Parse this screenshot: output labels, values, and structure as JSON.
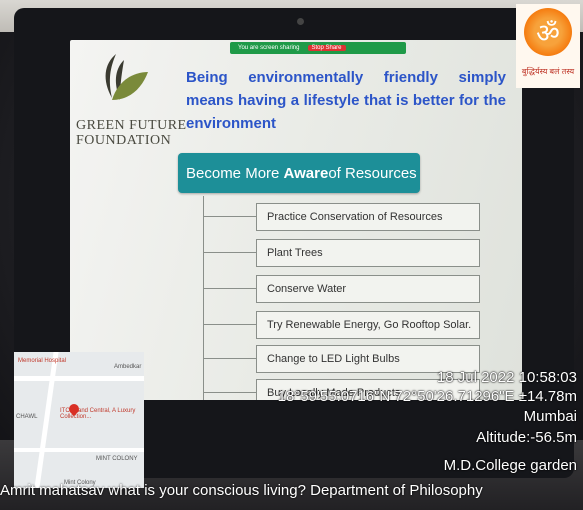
{
  "slide": {
    "share_bar": {
      "label": "You are screen sharing",
      "stop": "Stop Share"
    },
    "org_name_line1": "GREEN FUTURE",
    "org_name_line2": "FOUNDATION",
    "headline": "Being environmentally friendly simply means having a lifestyle that is better for the environment",
    "banner": {
      "pre": "Become More ",
      "bold": "Aware",
      "post": " of Resources"
    },
    "items": [
      "Practice Conservation of Resources",
      "Plant Trees",
      "Conserve Water",
      "Try Renewable Energy, Go Rooftop Solar.",
      "Change to LED Light Bulbs",
      "Buy Locally Made Products"
    ]
  },
  "map": {
    "labels": [
      "Memorial Hospital",
      "Ambedkar",
      "ITC Grand Central, A Luxury Collection...",
      "CHAWL",
      "MINT COLONY",
      "Mint Colony"
    ]
  },
  "overlay": {
    "datetime": "18 Jul 2022 10:58:03",
    "coords": "18°59'55.0716\"N 72°50'26.71296\"E ±14.78m",
    "city": "Mumbai",
    "altitude": "Altitude:-56.5m",
    "place": "M.D.College garden",
    "caption": "Amrit mahatsav what is your conscious living? Department of Philosophy"
  },
  "emblem": {
    "symbol": "ॐ",
    "text": "बुद्धिर्यस्य बलं तस्य"
  },
  "colors": {
    "headline": "#2c55c8",
    "banner": "#1d8f98",
    "share_bar": "#1f9a48",
    "emblem": "#f57c10"
  }
}
